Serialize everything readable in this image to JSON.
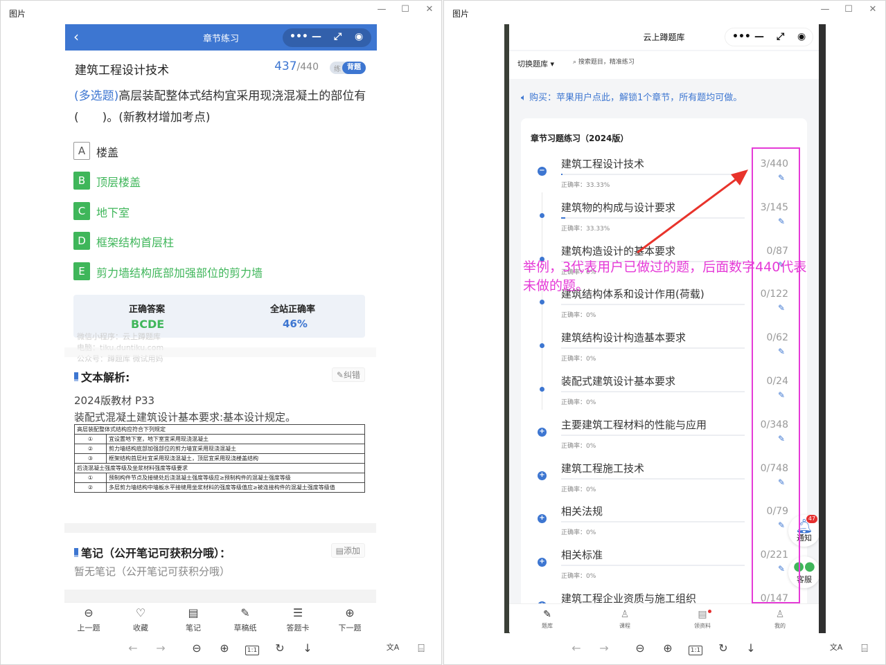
{
  "left_window": {
    "title": "图片",
    "controls": {
      "minimize": "—",
      "maximize": "☐",
      "close": "✕"
    },
    "phone": {
      "nav_title": "章节练习",
      "capsule": {
        "more": "•••",
        "minimize": "—",
        "restore": "⤢",
        "close": "◉"
      },
      "chapter": "建筑工程设计技术",
      "progress_current": "437",
      "progress_total": "/440",
      "mode_practice": "练",
      "mode_recite": "背题",
      "question_type": "(多选题)",
      "question_text": "高层装配整体式结构宜采用现浇混凝土的部位有(　　)。(新教材增加考点)",
      "options": [
        {
          "key": "A",
          "text": "楼盖",
          "correct": false
        },
        {
          "key": "B",
          "text": "顶层楼盖",
          "correct": true
        },
        {
          "key": "C",
          "text": "地下室",
          "correct": true
        },
        {
          "key": "D",
          "text": "框架结构首层柱",
          "correct": true
        },
        {
          "key": "E",
          "text": "剪力墙结构底部加强部位的剪力墙",
          "correct": true
        }
      ],
      "answer_label": "正确答案",
      "answer_value": "BCDE",
      "rate_label": "全站正确率",
      "rate_value": "46%",
      "watermark": [
        "微信小程序：云上蹲题库",
        "电脑：tiku.duntiku.com",
        "公众号：蹲题库 微试用妈"
      ],
      "analysis_title": "文本解析:",
      "report_button": "纠错",
      "analysis_lines": [
        "2024版教材 P33",
        "装配式混凝土建筑设计基本要求:基本设计规定。"
      ],
      "table": [
        [
          "高层装配整体式结构应符合下列规定",
          ""
        ],
        [
          "①",
          "宜设置地下室，地下室宜采用现浇混凝土"
        ],
        [
          "②",
          "剪力墙结构底部加强部位的剪力墙宜采用现浇混凝土"
        ],
        [
          "③",
          "框架结构首层柱宜采用现浇混凝土，顶层宜采用现浇楼盖结构"
        ],
        [
          "后浇混凝土强度等级及坐浆材料强度等级要求",
          ""
        ],
        [
          "①",
          "预制构件节点及接缝处后浇混凝土强度等级应≥预制构件的混凝土强度等级"
        ],
        [
          "②",
          "多层剪力墙结构中墙板水平接缝用坐浆材料的强度等级值应≥被连接构件的混凝土强度等级值"
        ]
      ],
      "notes_title": "笔记（公开笔记可获积分哦）：",
      "add_button": "添加",
      "notes_empty": "暂无笔记（公开笔记可获积分哦）",
      "bottom_nav": [
        {
          "icon": "⊖",
          "label": "上一题"
        },
        {
          "icon": "♡",
          "label": "收藏"
        },
        {
          "icon": "▤",
          "label": "笔记"
        },
        {
          "icon": "✎",
          "label": "草稿纸"
        },
        {
          "icon": "☰",
          "label": "答题卡"
        },
        {
          "icon": "⊕",
          "label": "下一题"
        }
      ]
    }
  },
  "right_window": {
    "title": "图片",
    "controls": {
      "minimize": "—",
      "maximize": "☐",
      "close": "✕"
    },
    "phone": {
      "nav_title": "云上蹲题库",
      "capsule": {
        "more": "•••",
        "minimize": "—",
        "restore": "⤢",
        "close": "◉"
      },
      "switch_bank": "切换题库",
      "search_placeholder": "搜索题目，精准练习",
      "notice": "购买：苹果用户点此，解锁1个章节，所有题均可做。",
      "card_title": "章节习题练习（2024版）",
      "chapters": [
        {
          "name": "建筑工程设计技术",
          "count": "3/440",
          "accuracy": "正确率：33.33%",
          "progress": 0.007,
          "marker": "minus"
        },
        {
          "name": "建筑物的构成与设计要求",
          "count": "3/145",
          "accuracy": "正确率：33.33%",
          "progress": 0.021,
          "marker": "dot"
        },
        {
          "name": "建筑构造设计的基本要求",
          "count": "0/87",
          "accuracy": "正确率：0%",
          "progress": 0,
          "marker": "dot"
        },
        {
          "name": "建筑结构体系和设计作用(荷载)",
          "count": "0/122",
          "accuracy": "正确率：0%",
          "progress": 0,
          "marker": "dot"
        },
        {
          "name": "建筑结构设计构造基本要求",
          "count": "0/62",
          "accuracy": "正确率：0%",
          "progress": 0,
          "marker": "dot"
        },
        {
          "name": "装配式建筑设计基本要求",
          "count": "0/24",
          "accuracy": "正确率：0%",
          "progress": 0,
          "marker": "dot"
        },
        {
          "name": "主要建筑工程材料的性能与应用",
          "count": "0/348",
          "accuracy": "正确率：0%",
          "progress": 0,
          "marker": "plus"
        },
        {
          "name": "建筑工程施工技术",
          "count": "0/748",
          "accuracy": "正确率：0%",
          "progress": 0,
          "marker": "plus"
        },
        {
          "name": "相关法规",
          "count": "0/79",
          "accuracy": "正确率：0%",
          "progress": 0,
          "marker": "plus"
        },
        {
          "name": "相关标准",
          "count": "0/221",
          "accuracy": "正确率：0%",
          "progress": 0,
          "marker": "plus"
        },
        {
          "name": "建筑工程企业资质与施工组织",
          "count": "0/147",
          "accuracy": "",
          "progress": 0,
          "marker": "plus"
        }
      ],
      "notify_label": "通知",
      "notify_badge": "47",
      "service_label": "客服",
      "bottom_nav": [
        {
          "icon": "✎",
          "label": "题库"
        },
        {
          "icon": "♙",
          "label": "课程"
        },
        {
          "icon": "▤",
          "label": "领资料"
        },
        {
          "icon": "♙",
          "label": "我的"
        }
      ]
    },
    "annotation": "举例，3代表用户已做过的题，后面数字440代表未做的题。",
    "accent_color": "#e53ad7"
  },
  "viewer_toolbar": {
    "prev": "←",
    "next": "→",
    "zoom_out": "⊖",
    "zoom_in": "⊕",
    "actual_size": "1:1",
    "rotate": "↻",
    "download": "↓",
    "translate": "文A",
    "ocr": "⌸"
  },
  "colors": {
    "brand": "#3d76d1",
    "correct": "#3fb65a",
    "annotation": "#e53ad7"
  }
}
